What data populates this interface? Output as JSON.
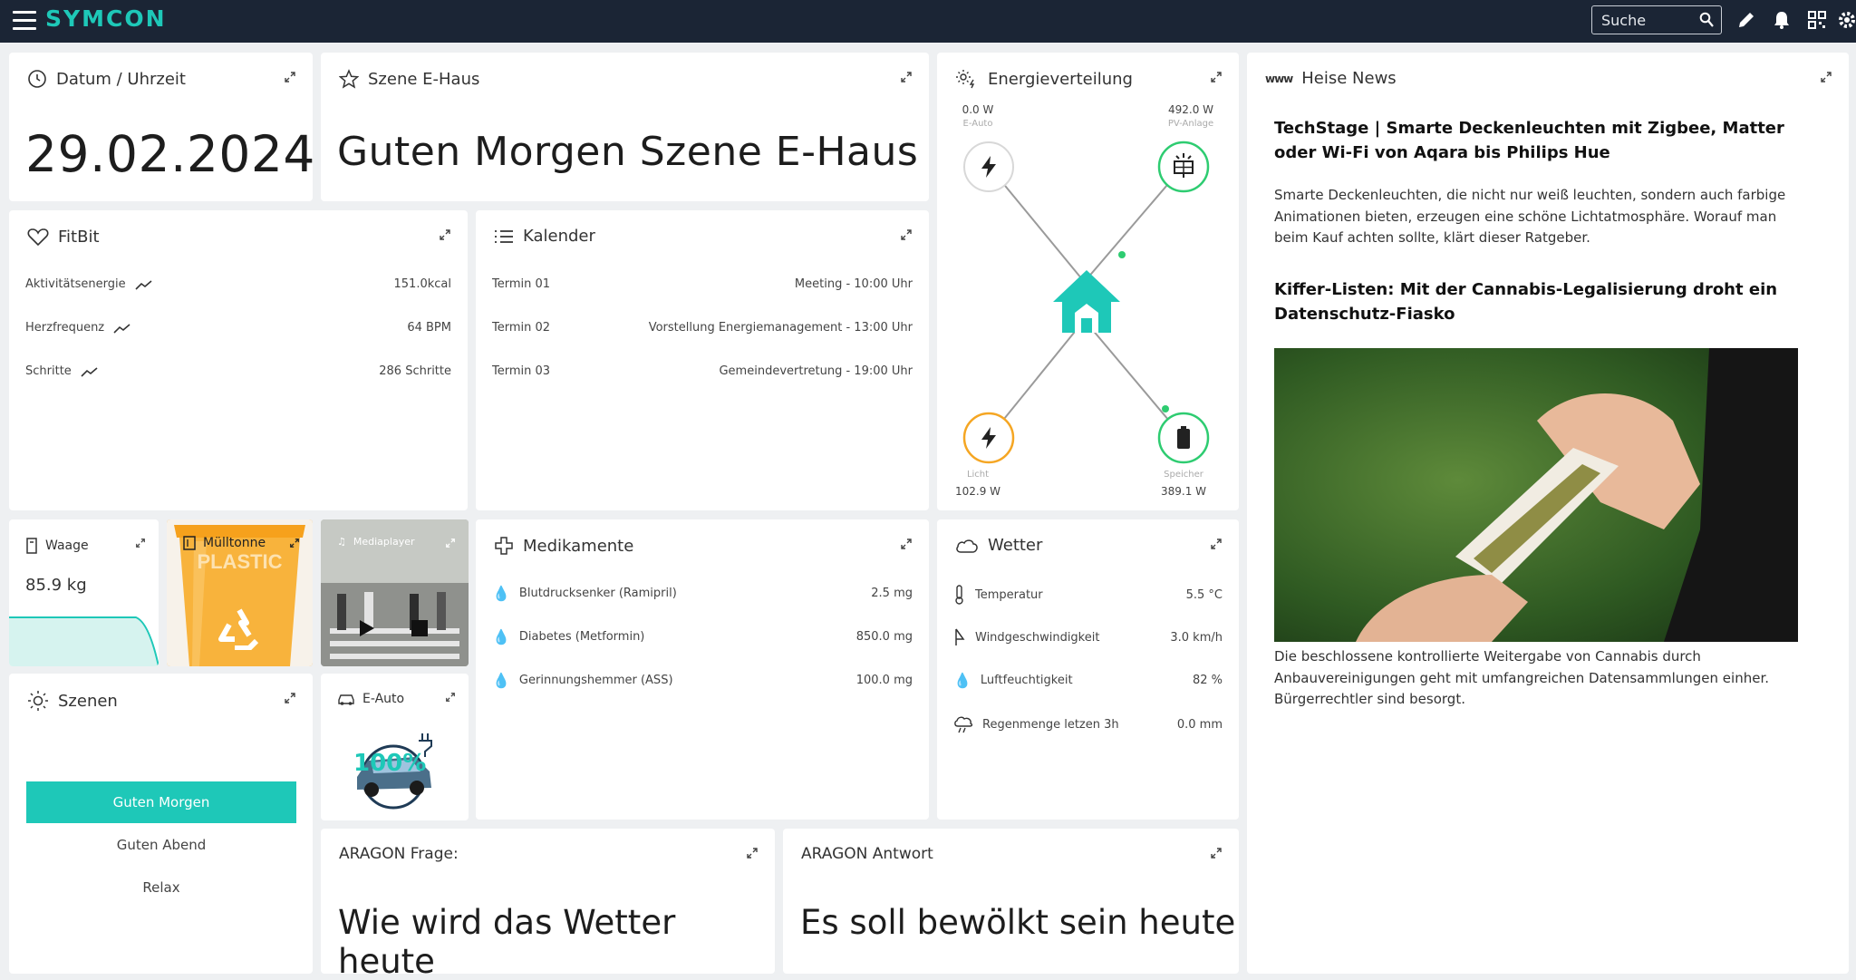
{
  "app": {
    "logo": "SYMCON"
  },
  "topbar": {
    "search_placeholder": "Suche"
  },
  "datum": {
    "title": "Datum / Uhrzeit",
    "value": "29.02.2024"
  },
  "szene_ehaus": {
    "title": "Szene E-Haus",
    "value": "Guten Morgen Szene E-Haus"
  },
  "energie": {
    "title": "Energieverteilung",
    "eauto": {
      "value": "0.0 W",
      "label": "E-Auto"
    },
    "pv": {
      "value": "492.0 W",
      "label": "PV-Anlage"
    },
    "licht": {
      "value": "102.9 W",
      "label": "Licht"
    },
    "speicher": {
      "value": "389.1 W",
      "label": "Speicher"
    }
  },
  "news": {
    "title": "Heise News",
    "items": [
      {
        "title": "TechStage | Smarte Deckenleuchten mit Zigbee, Matter oder Wi-Fi von Aqara bis Philips Hue",
        "body": "Smarte Deckenleuchten, die nicht nur weiß leuchten, sondern auch farbige Animationen bieten, erzeugen eine schöne Lichtatmosphäre. Worauf man beim Kauf achten sollte, klärt dieser Ratgeber."
      },
      {
        "title": "Kiffer-Listen: Mit der Cannabis-Legalisierung droht ein Datenschutz-Fiasko",
        "body": "Die beschlossene kontrollierte Weitergabe von Cannabis durch Anbauvereinigungen geht mit umfangreichen Datensammlungen einher. Bürgerrechtler sind besorgt."
      }
    ]
  },
  "fitbit": {
    "title": "FitBit",
    "rows": [
      {
        "label": "Aktivitätsenergie",
        "value": "151.0kcal"
      },
      {
        "label": "Herzfrequenz",
        "value": "64 BPM"
      },
      {
        "label": "Schritte",
        "value": "286 Schritte"
      }
    ]
  },
  "kalender": {
    "title": "Kalender",
    "rows": [
      {
        "label": "Termin 01",
        "value": "Meeting - 10:00 Uhr"
      },
      {
        "label": "Termin 02",
        "value": "Vorstellung Energiemanagement - 13:00 Uhr"
      },
      {
        "label": "Termin 03",
        "value": "Gemeindevertretung - 19:00 Uhr"
      }
    ]
  },
  "waage": {
    "title": "Waage",
    "value": "85.9 kg"
  },
  "muelltonne": {
    "title": "Mülltonne",
    "label": "PLASTIC"
  },
  "mediaplayer": {
    "title": "Mediaplayer"
  },
  "medikamente": {
    "title": "Medikamente",
    "rows": [
      {
        "label": "Blutdrucksenker (Ramipril)",
        "value": "2.5 mg"
      },
      {
        "label": "Diabetes (Metformin)",
        "value": "850.0 mg"
      },
      {
        "label": "Gerinnungshemmer (ASS)",
        "value": "100.0 mg"
      }
    ]
  },
  "wetter": {
    "title": "Wetter",
    "rows": [
      {
        "label": "Temperatur",
        "value": "5.5 °C"
      },
      {
        "label": "Windgeschwindigkeit",
        "value": "3.0 km/h"
      },
      {
        "label": "Luftfeuchtigkeit",
        "value": "82 %"
      },
      {
        "label": "Regenmenge letzen 3h",
        "value": "0.0 mm"
      }
    ]
  },
  "szenen": {
    "title": "Szenen",
    "buttons": [
      "Guten Morgen",
      "Guten Abend",
      "Relax"
    ]
  },
  "eauto": {
    "title": "E-Auto",
    "level": "100%"
  },
  "aragon_frage": {
    "title": "ARAGON Frage:",
    "value": "Wie wird das Wetter heute"
  },
  "aragon_antwort": {
    "title": "ARAGON Antwort",
    "value": "Es soll bewölkt sein heute"
  },
  "colors": {
    "accent": "#1ec8b8",
    "topbar": "#1b2535",
    "bin": "#f5a623",
    "speicher_ring": "#2ecc71",
    "licht_ring": "#f5a623"
  }
}
